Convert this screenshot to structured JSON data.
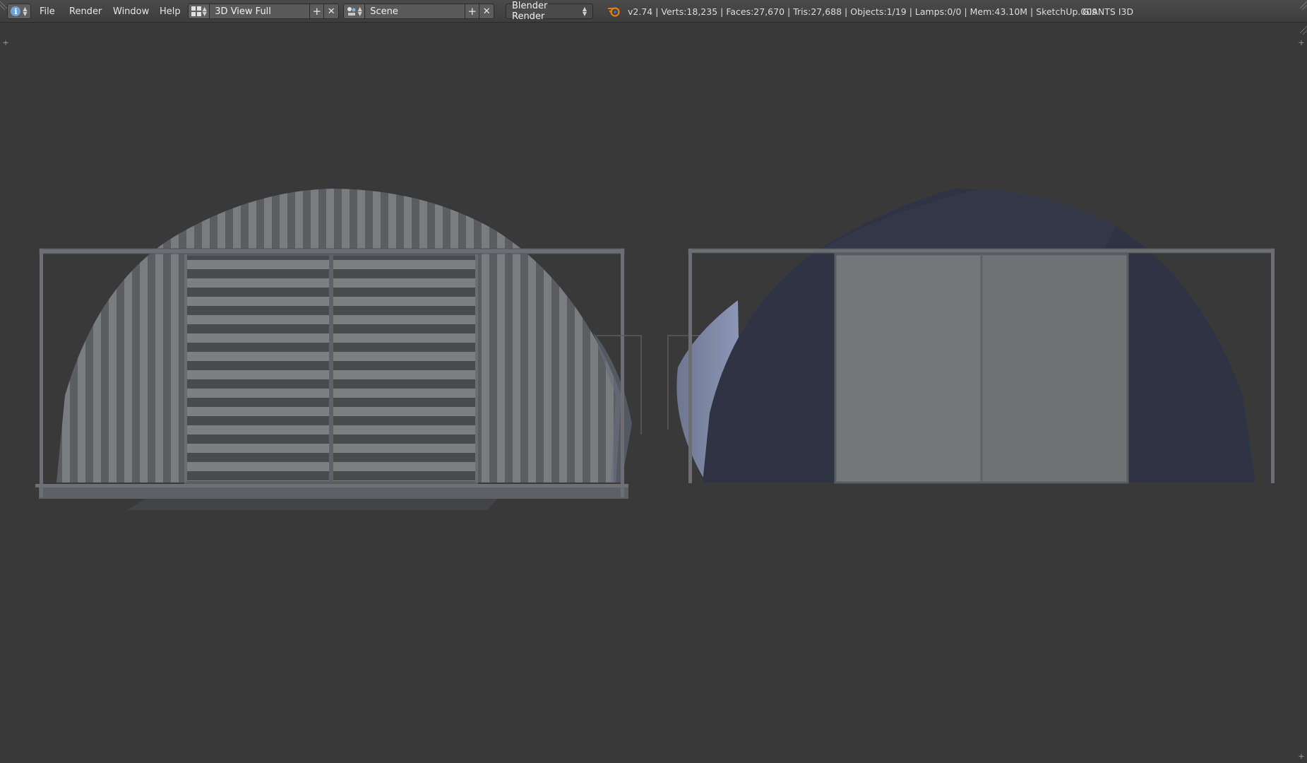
{
  "topbar": {
    "editor_icon": "info-icon",
    "menus": [
      "File",
      "Render",
      "Window",
      "Help"
    ],
    "screen_layout": {
      "icon": "screen-layout-icon",
      "value": "3D View Full",
      "add_icon": "add-icon",
      "delete_icon": "close-icon"
    },
    "scene": {
      "icon": "scene-icon",
      "value": "Scene",
      "add_icon": "add-icon",
      "delete_icon": "close-icon"
    },
    "render_engine": "Blender Render",
    "blender_icon": "blender-logo-icon",
    "stats": "v2.74 | Verts:18,235 | Faces:27,670 | Tris:27,688 | Objects:1/19 | Lamps:0/0 | Mem:43.10M | SketchUp.009",
    "addon_label": "GIANTS I3D"
  },
  "viewport": {
    "background": "#393939",
    "objects": [
      "hangar-left-corrugated",
      "hangar-right-dark"
    ]
  },
  "colors": {
    "header_bg": "#454545",
    "field_bg": "#595959",
    "accent_blue": "#6fa0d8",
    "blender_orange": "#e87d0d"
  }
}
